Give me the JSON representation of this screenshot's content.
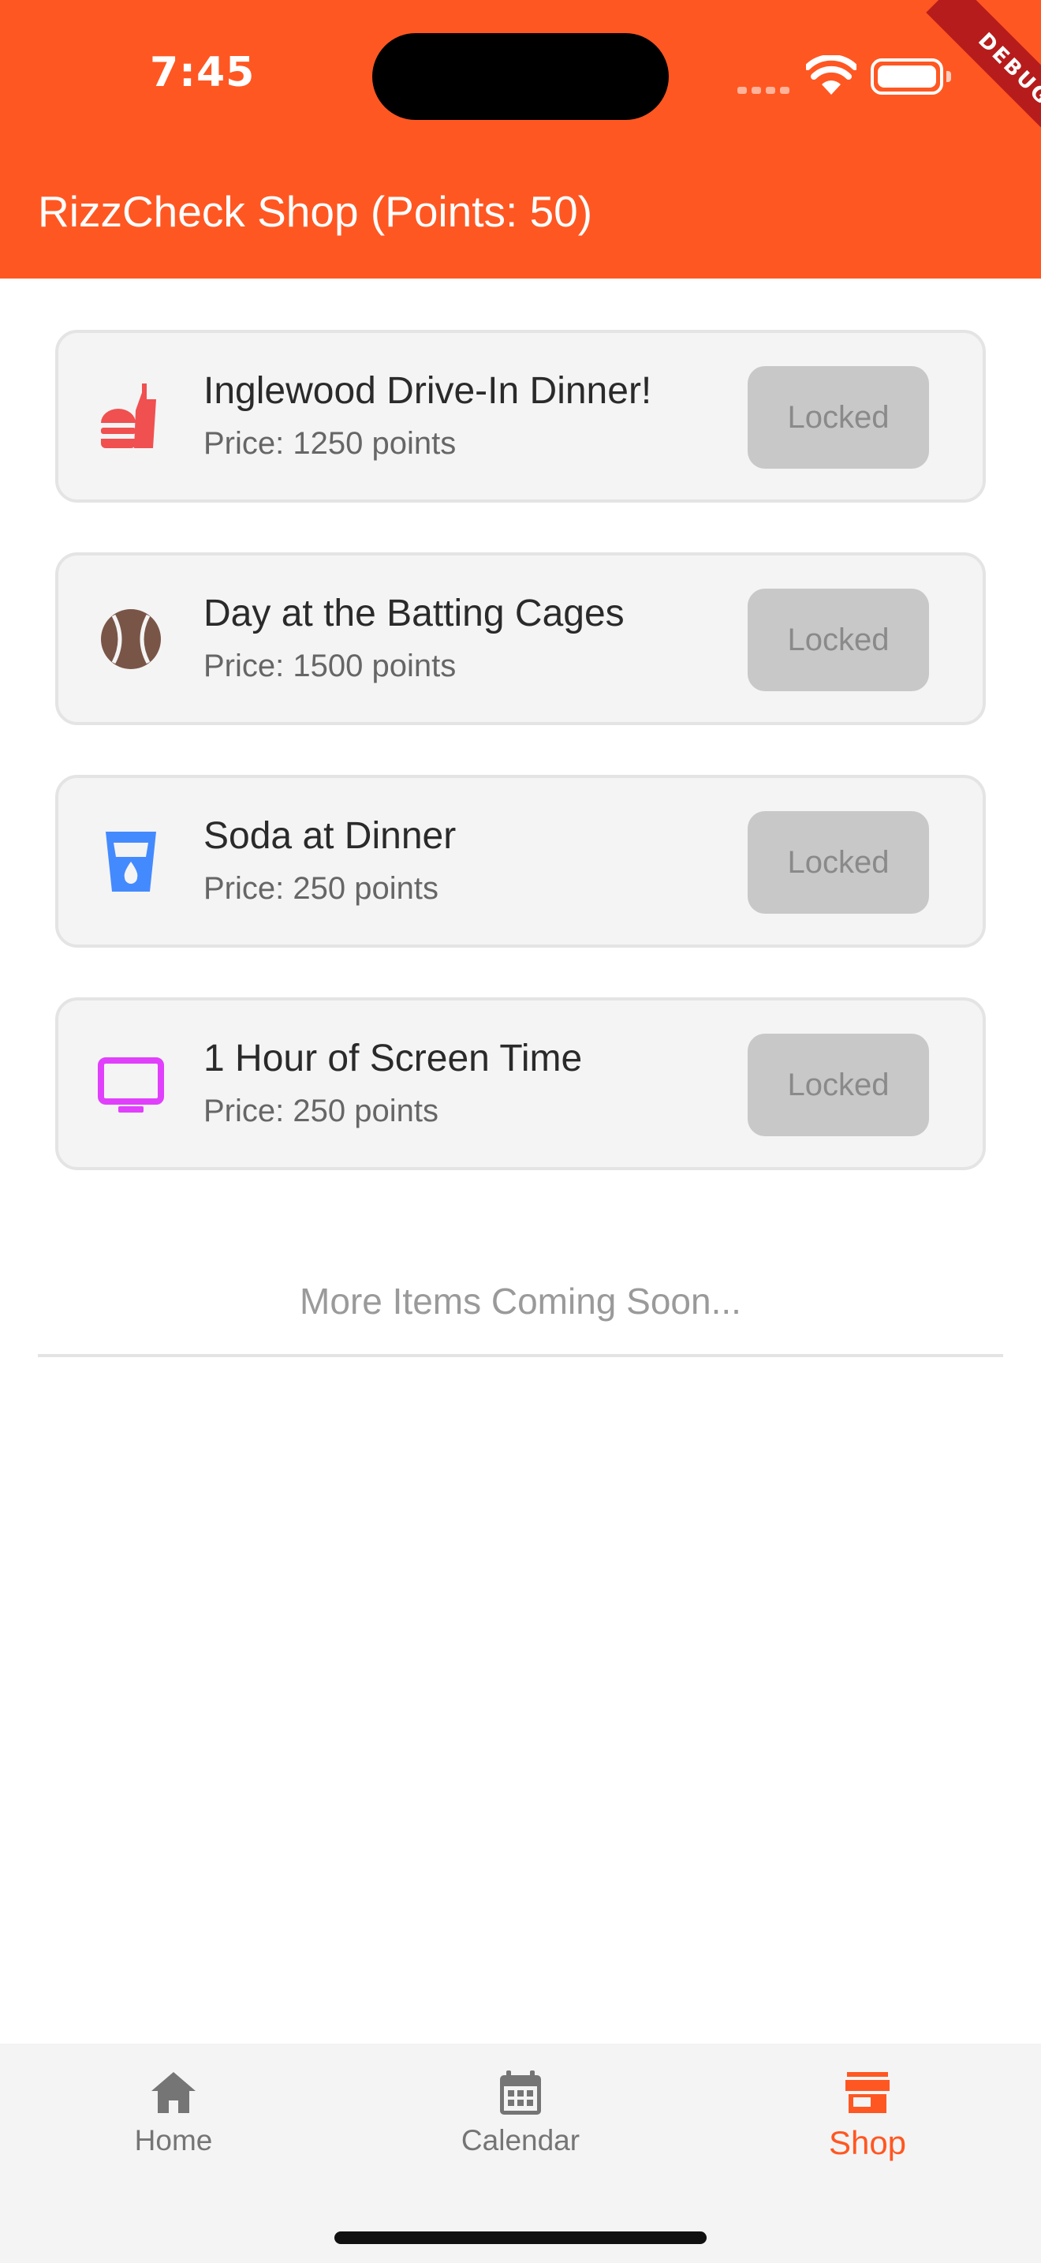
{
  "status_bar": {
    "time": "7:45"
  },
  "debug_banner": "DEBUG",
  "app_bar": {
    "title": "RizzCheck Shop (Points: 50)"
  },
  "shop_items": [
    {
      "title": "Inglewood Drive-In Dinner!",
      "price": "Price: 1250 points",
      "button": "Locked",
      "icon": "fastfood-icon",
      "icon_color": "#F05050"
    },
    {
      "title": "Day at the Batting Cages",
      "price": "Price: 1500 points",
      "button": "Locked",
      "icon": "baseball-icon",
      "icon_color": "#795548"
    },
    {
      "title": "Soda at Dinner",
      "price": "Price: 250 points",
      "button": "Locked",
      "icon": "drink-icon",
      "icon_color": "#448AFF"
    },
    {
      "title": "1 Hour of Screen Time",
      "price": "Price: 250 points",
      "button": "Locked",
      "icon": "tv-icon",
      "icon_color": "#E040FB"
    }
  ],
  "footer_text": "More Items Coming Soon...",
  "bottom_nav": {
    "items": [
      {
        "label": "Home",
        "icon": "home-icon",
        "active": false
      },
      {
        "label": "Calendar",
        "icon": "calendar-icon",
        "active": false
      },
      {
        "label": "Shop",
        "icon": "store-icon",
        "active": true
      }
    ]
  },
  "colors": {
    "accent": "#FF5722",
    "card_bg": "#F4F4F4",
    "locked_button": "#C8C8C8",
    "nav_inactive": "#757575"
  }
}
